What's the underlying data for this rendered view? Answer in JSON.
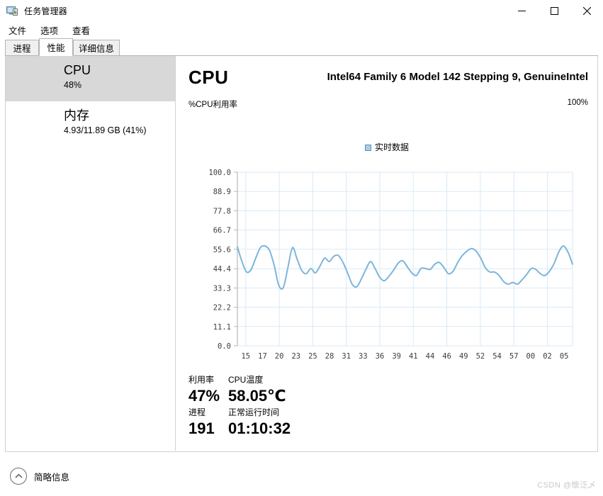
{
  "window": {
    "title": "任务管理器",
    "icon": "task-manager-icon",
    "minimize": "—",
    "maximize": "□",
    "close": "✕"
  },
  "menu": {
    "items": [
      {
        "label": "文件"
      },
      {
        "label": "选项"
      },
      {
        "label": "查看"
      }
    ]
  },
  "tabs": [
    {
      "label": "进程",
      "selected": false
    },
    {
      "label": "性能",
      "selected": true
    },
    {
      "label": "详细信息",
      "selected": false
    }
  ],
  "sidebar": {
    "items": [
      {
        "title": "CPU",
        "sub": "48%",
        "active": true
      },
      {
        "title": "内存",
        "sub": "4.93/11.89 GB (41%)",
        "active": false
      }
    ]
  },
  "main": {
    "heading": "CPU",
    "processor": "Intel64 Family 6 Model 142 Stepping 9, GenuineIntel",
    "axis_caption_left": "%CPU利用率",
    "axis_caption_right": "100%"
  },
  "stats": {
    "utilization_label": "利用率",
    "utilization_value": "47%",
    "temperature_label": "CPU温度",
    "temperature_value": "58.05℃",
    "processes_label": "进程",
    "processes_value": "191",
    "uptime_label": "正常运行时间",
    "uptime_value": "01:10:32"
  },
  "footer": {
    "icon": "chevron-up-icon",
    "label": "简略信息"
  },
  "watermark": "CSDN @懷泛乄",
  "colors": {
    "line": "#7cb5da",
    "grid": "#d9eaf6",
    "axis": "#b7b7b7",
    "legend_swatch": "#a8cde8",
    "sidebar_active": "#d8d8d8",
    "accent_blue": "#0078d7"
  },
  "chart_data": {
    "type": "line",
    "title": "",
    "xlabel": "",
    "ylabel": "%CPU利用率",
    "legend": [
      "实时数据"
    ],
    "legend_position": "top-center",
    "grid": true,
    "ylim": [
      0,
      100
    ],
    "yticks": [
      0.0,
      11.1,
      22.2,
      33.3,
      44.4,
      55.6,
      66.7,
      77.8,
      88.9,
      100.0
    ],
    "ytick_labels": [
      "0.0",
      "11.1",
      "22.2",
      "33.3",
      "44.4",
      "55.6",
      "66.7",
      "77.8",
      "88.9",
      "100.0"
    ],
    "xticks": [
      "15",
      "17",
      "20",
      "23",
      "25",
      "28",
      "31",
      "33",
      "36",
      "39",
      "41",
      "44",
      "46",
      "49",
      "52",
      "54",
      "57",
      "00",
      "02",
      "05"
    ],
    "series": [
      {
        "name": "实时数据",
        "color": "#7cb5da",
        "values": [
          57.0,
          48.5,
          42.5,
          44.0,
          50.5,
          56.5,
          57.5,
          55.0,
          46.5,
          35.0,
          33.5,
          45.0,
          56.5,
          50.0,
          43.5,
          41.5,
          44.5,
          42.0,
          46.0,
          50.5,
          48.5,
          51.5,
          52.0,
          48.0,
          42.0,
          35.5,
          34.0,
          38.5,
          44.0,
          48.5,
          44.5,
          39.5,
          37.5,
          40.0,
          43.5,
          47.5,
          49.0,
          45.5,
          42.0,
          40.5,
          44.5,
          44.5,
          44.0,
          47.0,
          48.0,
          45.0,
          41.5,
          43.0,
          48.0,
          52.0,
          54.5,
          56.0,
          54.5,
          50.5,
          45.0,
          42.5,
          42.5,
          40.5,
          37.0,
          35.5,
          36.5,
          35.5,
          38.0,
          41.0,
          44.5,
          44.0,
          41.5,
          40.5,
          43.0,
          47.5,
          54.0,
          57.5,
          54.0,
          47.0
        ]
      }
    ]
  }
}
